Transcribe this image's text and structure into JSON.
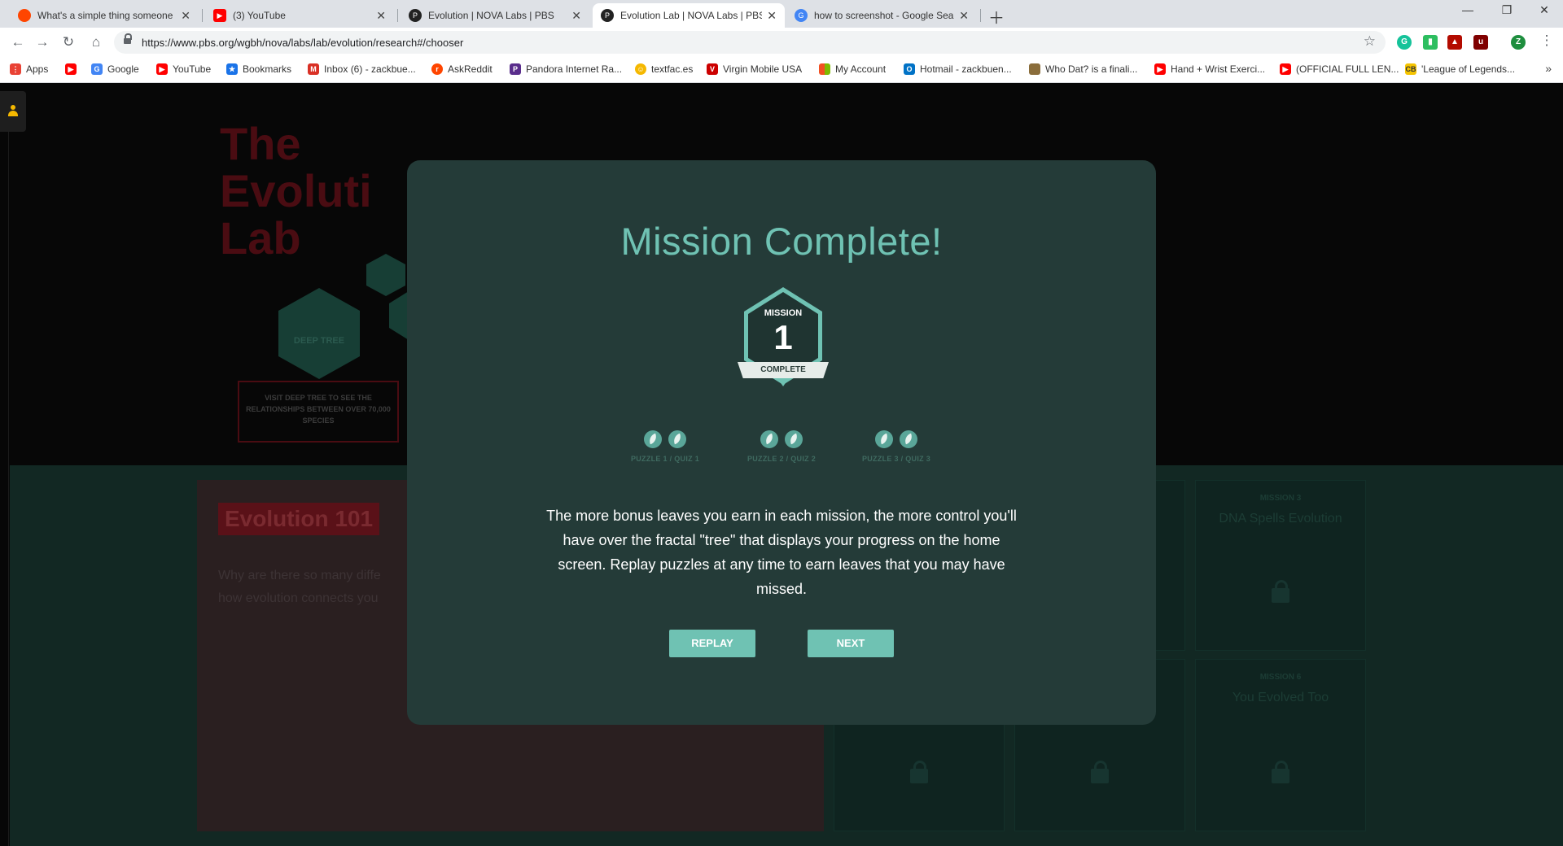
{
  "browser": {
    "tabs": [
      {
        "title": "What's a simple thing someone c",
        "icon": "reddit-icon",
        "color": "#ff4500"
      },
      {
        "title": "(3) YouTube",
        "icon": "youtube-icon",
        "color": "#ff0000"
      },
      {
        "title": "Evolution | NOVA Labs | PBS",
        "icon": "pbs-icon",
        "color": "#222222"
      },
      {
        "title": "Evolution Lab | NOVA Labs | PBS",
        "icon": "pbs-icon",
        "color": "#222222",
        "active": true
      },
      {
        "title": "how to screenshot - Google Sear",
        "icon": "google-icon",
        "color": "#4285f4"
      }
    ],
    "url": "https://www.pbs.org/wgbh/nova/labs/lab/evolution/research#/chooser",
    "bookmarks": [
      {
        "label": "Apps",
        "icon": "apps-icon",
        "color": "#e94235"
      },
      {
        "label": "",
        "icon": "youtube-icon",
        "color": "#ff0000"
      },
      {
        "label": "Google",
        "icon": "google-icon",
        "color": "#4285f4"
      },
      {
        "label": "YouTube",
        "icon": "youtube-icon",
        "color": "#ff0000"
      },
      {
        "label": "Bookmarks",
        "icon": "star-icon",
        "color": "#1a73e8"
      },
      {
        "label": "Inbox (6) - zackbue...",
        "icon": "gmail-icon",
        "color": "#d93025"
      },
      {
        "label": "AskReddit",
        "icon": "reddit-icon",
        "color": "#ff4500"
      },
      {
        "label": "Pandora Internet Ra...",
        "icon": "pandora-icon",
        "color": "#5a2d8c"
      },
      {
        "label": "textfac.es",
        "icon": "emoji-icon",
        "color": "#f5b800"
      },
      {
        "label": "Virgin Mobile USA",
        "icon": "virgin-icon",
        "color": "#cc0000"
      },
      {
        "label": "My Account",
        "icon": "microsoft-icon",
        "color": "#f25022"
      },
      {
        "label": "Hotmail - zackbuen...",
        "icon": "outlook-icon",
        "color": "#0072c6"
      },
      {
        "label": "Who Dat? is a finali...",
        "icon": "image-icon",
        "color": "#8a6d3b"
      },
      {
        "label": "Hand + Wrist Exerci...",
        "icon": "youtube-icon",
        "color": "#ff0000"
      },
      {
        "label": "(OFFICIAL FULL LEN...",
        "icon": "youtube-icon",
        "color": "#ff0000"
      },
      {
        "label": "'League of Legends...",
        "icon": "cb-icon",
        "color": "#f5c400"
      }
    ],
    "extensions": [
      {
        "icon": "grammarly-icon",
        "color": "#15c39a",
        "text": "G"
      },
      {
        "icon": "evernote-icon",
        "color": "#2dbe60",
        "text": "▮"
      },
      {
        "icon": "pdf-icon",
        "color": "#b30b00",
        "text": "▲"
      },
      {
        "icon": "ublock-icon",
        "color": "#800000",
        "text": "u"
      },
      {
        "icon": "profile-icon",
        "color": "#1e8e3e",
        "text": "Z"
      }
    ]
  },
  "background": {
    "title_lines": [
      "The",
      "Evoluti",
      "Lab"
    ],
    "deep_tree_label": "DEEP TREE",
    "deep_tree_callout": "VISIT DEEP TREE TO SEE THE RELATIONSHIPS BETWEEN OVER 70,000 SPECIES",
    "evolution_heading": "Evolution 101",
    "evolution_desc_lines": [
      "Why are there so many diffe",
      "how evolution connects you"
    ],
    "missions": [
      {
        "label": "MISSION 3",
        "name": "DNA Spells Evolution"
      },
      {
        "label": "MISSION 6",
        "name": "You Evolved Too"
      }
    ]
  },
  "modal": {
    "title": "Mission Complete!",
    "badge": {
      "top": "MISSION",
      "number": "1",
      "ribbon": "COMPLETE"
    },
    "puzzles": [
      {
        "label": "PUZZLE 1 / QUIZ 1",
        "leaves": 2
      },
      {
        "label": "PUZZLE 2 / QUIZ 2",
        "leaves": 2
      },
      {
        "label": "PUZZLE 3 / QUIZ 3",
        "leaves": 2
      }
    ],
    "body": "The more bonus leaves you earn in each mission, the more control you'll have over the fractal \"tree\" that displays your progress on the home screen. Replay puzzles at any time to earn leaves that you may have missed.",
    "replay_label": "REPLAY",
    "next_label": "NEXT",
    "accent_color": "#6fc2b3",
    "panel_color": "#243b38"
  }
}
